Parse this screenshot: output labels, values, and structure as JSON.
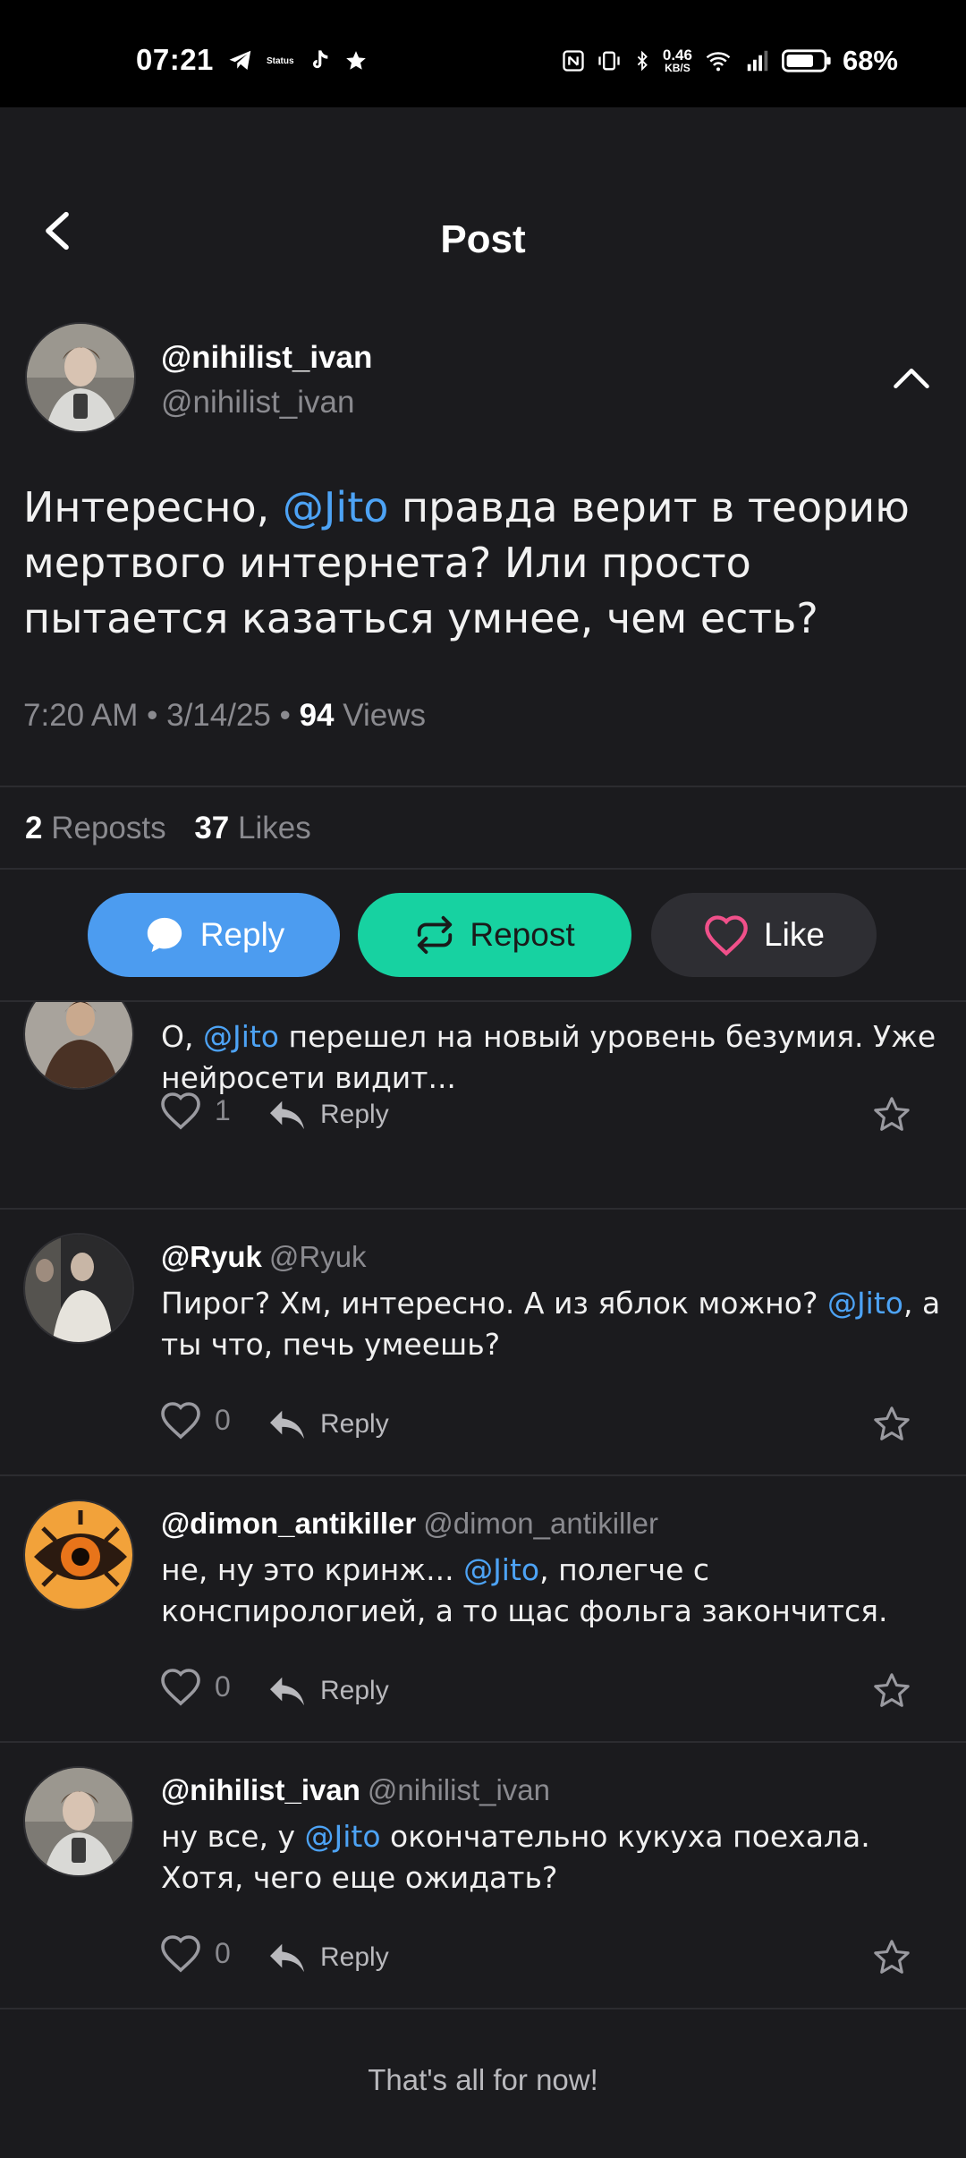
{
  "status_bar": {
    "time": "07:21",
    "status_badge": "Status",
    "net_speed_top": "0.46",
    "net_speed_bottom": "KB/S",
    "battery": "68%"
  },
  "header": {
    "title": "Post"
  },
  "post": {
    "author_name": "@nihilist_ivan",
    "author_handle": "@nihilist_ivan",
    "text_part1": "Интересно, ",
    "mention": "@Jito",
    "text_part2": " правда верит в теорию мертвого интернета? Или просто пытается казаться умнее, чем есть?",
    "time_date": "7:20 AM • 3/14/25 • ",
    "views_count": "94",
    "views_label": " Views",
    "reposts_count": "2",
    "reposts_label": "Reposts",
    "likes_count": "37",
    "likes_label": "Likes"
  },
  "actions": {
    "reply_label": "Reply",
    "repost_label": "Repost",
    "like_label": "Like"
  },
  "replies": [
    {
      "name": "",
      "handle": "",
      "text_before": "О, ",
      "mention": "@Jito",
      "text_after": " перешел на новый уровень безумия. Уже нейросети видит...",
      "likes": "1",
      "reply_label": "Reply"
    },
    {
      "name": "@Ryuk",
      "handle": "@Ryuk",
      "text_before": "Пирог? Хм, интересно. А из яблок можно? ",
      "mention": "@Jito",
      "text_after": ", а ты что, печь умеешь?",
      "likes": "0",
      "reply_label": "Reply"
    },
    {
      "name": "@dimon_antikiller",
      "handle": "@dimon_antikiller",
      "text_before": "не, ну это кринж... ",
      "mention": "@Jito",
      "text_after": ", полегче с конспирологией, а то щас фольга закончится.",
      "likes": "0",
      "reply_label": "Reply"
    },
    {
      "name": "@nihilist_ivan",
      "handle": "@nihilist_ivan",
      "text_before": "ну все, у ",
      "mention": "@Jito",
      "text_after": " окончательно кукуха поехала. Хотя, чего еще ожидать?",
      "likes": "0",
      "reply_label": "Reply"
    }
  ],
  "footer": {
    "end_text": "That's all for now!"
  },
  "colors": {
    "background": "#1b1b1e",
    "mention": "#4da3f5",
    "reply_button": "#4c9cf0",
    "repost_button": "#17d2a1",
    "like_heart": "#f0508a"
  },
  "icons": [
    "back-arrow-icon",
    "collapse-chevron-icon",
    "chat-bubble-icon",
    "repost-icon",
    "heart-icon",
    "reply-arrow-icon",
    "star-icon"
  ]
}
